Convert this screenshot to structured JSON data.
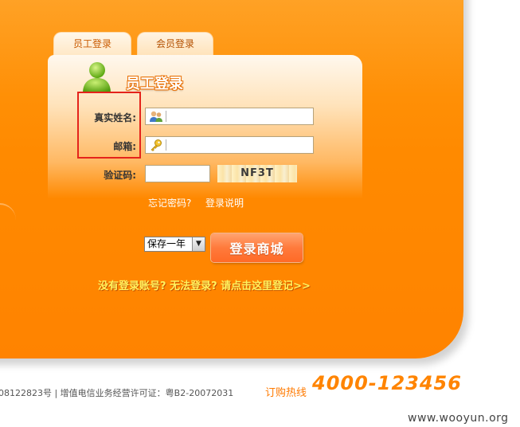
{
  "tabs": [
    {
      "label": "员工登录",
      "active": true
    },
    {
      "label": "会员登录",
      "active": false
    }
  ],
  "form": {
    "title": "员工登录",
    "name_label": "真实姓名:",
    "name_value": "",
    "email_label": "邮箱:",
    "email_value": "",
    "captcha_label": "验证码:",
    "captcha_value": "",
    "captcha_text": "NF3T",
    "forgot_link": "忘记密码?",
    "help_link": "登录说明"
  },
  "remember": {
    "selected": "保存一年"
  },
  "login_button": "登录商城",
  "help_prompt": "没有登录账号? 无法登录? 请点击这里登记>>",
  "footer": {
    "license": "08122823号 | 增值电信业务经营许可证：粤B2-20072031",
    "hotline_label": "订购热线",
    "hotline_number": "4000-123456"
  },
  "watermark": "www.wooyun.org",
  "colors": {
    "panel_orange": "#ff8a00",
    "highlight_box": "#e4231b",
    "link_yellow": "#fff25e"
  },
  "icons": [
    "user-avatar-icon",
    "users-icon",
    "key-icon",
    "dropdown-arrow-icon"
  ]
}
